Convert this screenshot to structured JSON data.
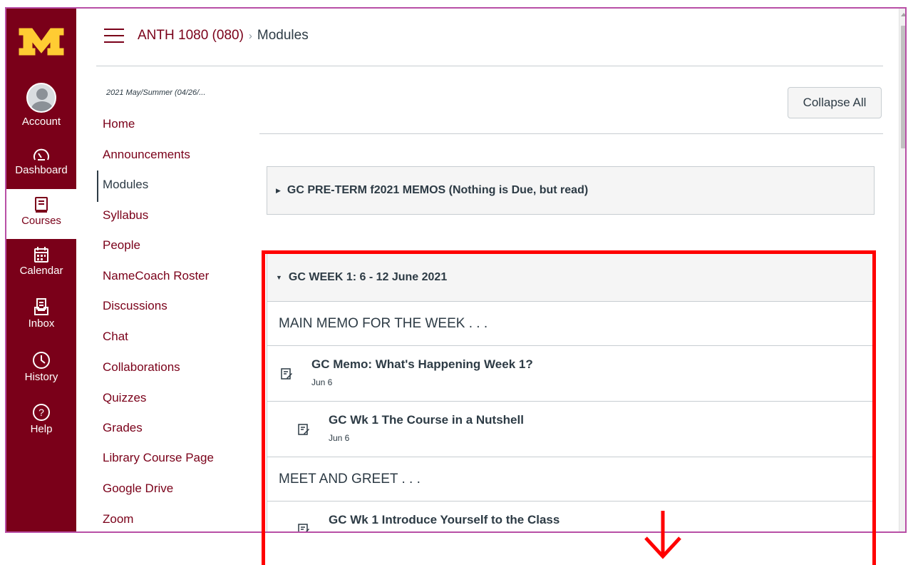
{
  "global_nav": {
    "logo_text": "M",
    "items": [
      {
        "label": "Account",
        "icon": "account-avatar-icon"
      },
      {
        "label": "Dashboard",
        "icon": "dashboard-gauge-icon"
      },
      {
        "label": "Courses",
        "icon": "courses-book-icon"
      },
      {
        "label": "Calendar",
        "icon": "calendar-icon"
      },
      {
        "label": "Inbox",
        "icon": "inbox-icon"
      },
      {
        "label": "History",
        "icon": "clock-icon"
      },
      {
        "label": "Help",
        "icon": "question-icon"
      }
    ],
    "colors": {
      "background": "#7a0019",
      "logo": "#ffcc33"
    }
  },
  "header": {
    "course": "ANTH 1080 (080)",
    "separator": "›",
    "current": "Modules"
  },
  "course_nav": {
    "term": "2021 May/Summer (04/26/...",
    "items": [
      {
        "label": "Home"
      },
      {
        "label": "Announcements"
      },
      {
        "label": "Modules",
        "active": true
      },
      {
        "label": "Syllabus"
      },
      {
        "label": "People"
      },
      {
        "label": "NameCoach Roster"
      },
      {
        "label": "Discussions"
      },
      {
        "label": "Chat"
      },
      {
        "label": "Collaborations"
      },
      {
        "label": "Quizzes"
      },
      {
        "label": "Grades"
      },
      {
        "label": "Library Course Page"
      },
      {
        "label": "Google Drive"
      },
      {
        "label": "Zoom"
      }
    ]
  },
  "toolbar": {
    "collapse_all": "Collapse All"
  },
  "modules": [
    {
      "title": "GC PRE-TERM f2021 MEMOS (Nothing is Due, but read)",
      "expanded": false
    },
    {
      "title": "GC WEEK 1: 6 - 12 June 2021",
      "expanded": true,
      "sections": [
        {
          "header": "MAIN MEMO FOR THE WEEK . . .",
          "items": [
            {
              "title": "GC Memo: What's Happening Week 1?",
              "date": "Jun 6"
            },
            {
              "title": "GC Wk 1 The Course in a Nutshell",
              "date": "Jun 6"
            }
          ]
        },
        {
          "header": "MEET AND GREET . . .",
          "items": [
            {
              "title": "GC Wk 1 Introduce Yourself to the Class",
              "date": ""
            }
          ]
        }
      ]
    }
  ],
  "annotation": {
    "color": "#ff0000"
  }
}
